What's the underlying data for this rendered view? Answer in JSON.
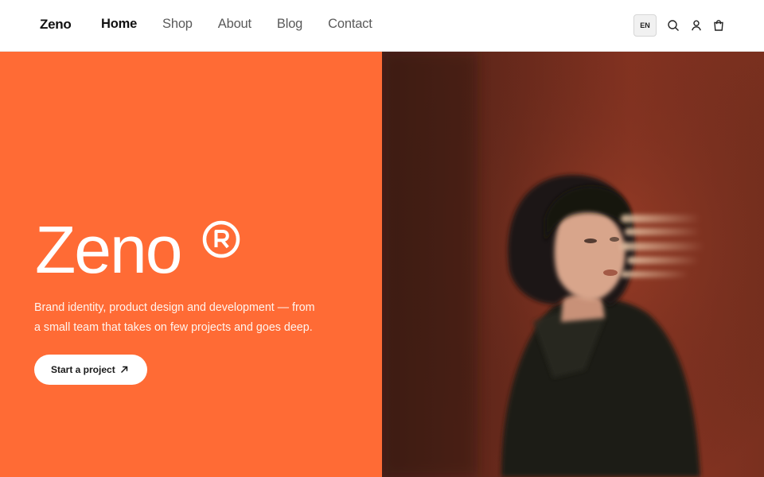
{
  "header": {
    "logo": "Zeno",
    "nav": [
      {
        "label": "Home",
        "active": true
      },
      {
        "label": "Shop",
        "active": false
      },
      {
        "label": "About",
        "active": false
      },
      {
        "label": "Blog",
        "active": false
      },
      {
        "label": "Contact",
        "active": false
      }
    ],
    "language": "EN",
    "icons": [
      "search-icon",
      "user-icon",
      "cart-icon"
    ]
  },
  "hero": {
    "title": "Zeno",
    "title_mark": "®",
    "description": "Brand identity, product design and development — from a small team that takes on few projects and goes deep.",
    "cta_label": "Start a project",
    "cta_icon": "arrow-up-right-icon",
    "accent_color": "#ff6b35"
  },
  "photo": {
    "subject": "portrait-photo"
  }
}
